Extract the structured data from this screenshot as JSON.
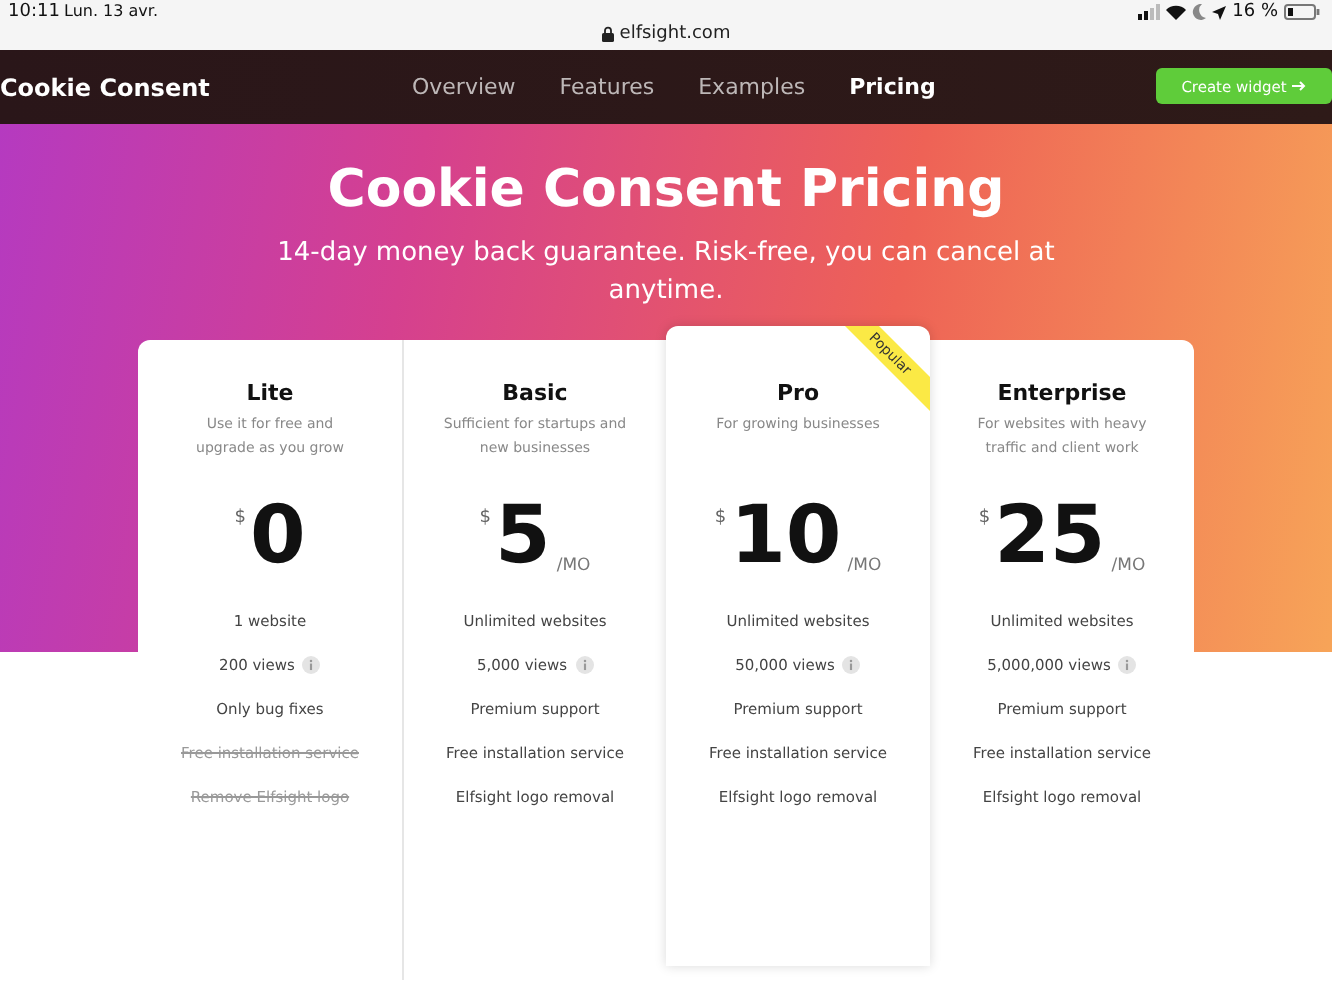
{
  "status_bar": {
    "time": "10:11",
    "date": "Lun. 13 avr.",
    "url": "elfsight.com",
    "battery": "16 %"
  },
  "nav": {
    "brand": "Cookie Consent",
    "links": [
      {
        "label": "Overview",
        "selected": false
      },
      {
        "label": "Features",
        "selected": false
      },
      {
        "label": "Examples",
        "selected": false
      },
      {
        "label": "Pricing",
        "selected": true
      }
    ],
    "button": "Create widget"
  },
  "hero": {
    "title": "Cookie Consent Pricing",
    "subtitle": "14-day money back guarantee. Risk-free, you can cancel at anytime."
  },
  "plans": [
    {
      "name": "Lite",
      "description": "Use it for free and upgrade as you grow",
      "currency": "$",
      "price": "0",
      "features": [
        {
          "text": "1 website",
          "info": false,
          "struck": false
        },
        {
          "text": "200 views",
          "info": true,
          "struck": false
        },
        {
          "text": "Only bug fixes",
          "info": false,
          "struck": false
        },
        {
          "text": "Free installation service",
          "info": false,
          "struck": true
        },
        {
          "text": "Remove Elfsight logo",
          "info": false,
          "struck": true
        }
      ]
    },
    {
      "name": "Basic",
      "description": "Sufficient for startups and new businesses",
      "currency": "$",
      "price": "5",
      "period": "/MO",
      "features": [
        {
          "text": "Unlimited websites",
          "info": false,
          "struck": false
        },
        {
          "text": "5,000 views",
          "info": true,
          "struck": false
        },
        {
          "text": "Premium support",
          "info": false,
          "struck": false
        },
        {
          "text": "Free installation service",
          "info": false,
          "struck": false
        },
        {
          "text": "Elfsight logo removal",
          "info": false,
          "struck": false
        }
      ]
    },
    {
      "name": "Pro",
      "badge": "Popular",
      "description": "For growing businesses",
      "currency": "$",
      "price": "10",
      "period": "/MO",
      "features": [
        {
          "text": "Unlimited websites",
          "info": false,
          "struck": false
        },
        {
          "text": "50,000 views",
          "info": true,
          "struck": false
        },
        {
          "text": "Premium support",
          "info": false,
          "struck": false
        },
        {
          "text": "Free installation service",
          "info": false,
          "struck": false
        },
        {
          "text": "Elfsight logo removal",
          "info": false,
          "struck": false
        }
      ]
    },
    {
      "name": "Enterprise",
      "description": "For websites with heavy traffic and client work",
      "currency": "$",
      "price": "25",
      "period": "/MO",
      "features": [
        {
          "text": "Unlimited websites",
          "info": false,
          "struck": false
        },
        {
          "text": "5,000,000 views",
          "info": true,
          "struck": false
        },
        {
          "text": "Premium support",
          "info": false,
          "struck": false
        },
        {
          "text": "Free installation service",
          "info": false,
          "struck": false
        },
        {
          "text": "Elfsight logo removal",
          "info": false,
          "struck": false
        }
      ]
    }
  ]
}
